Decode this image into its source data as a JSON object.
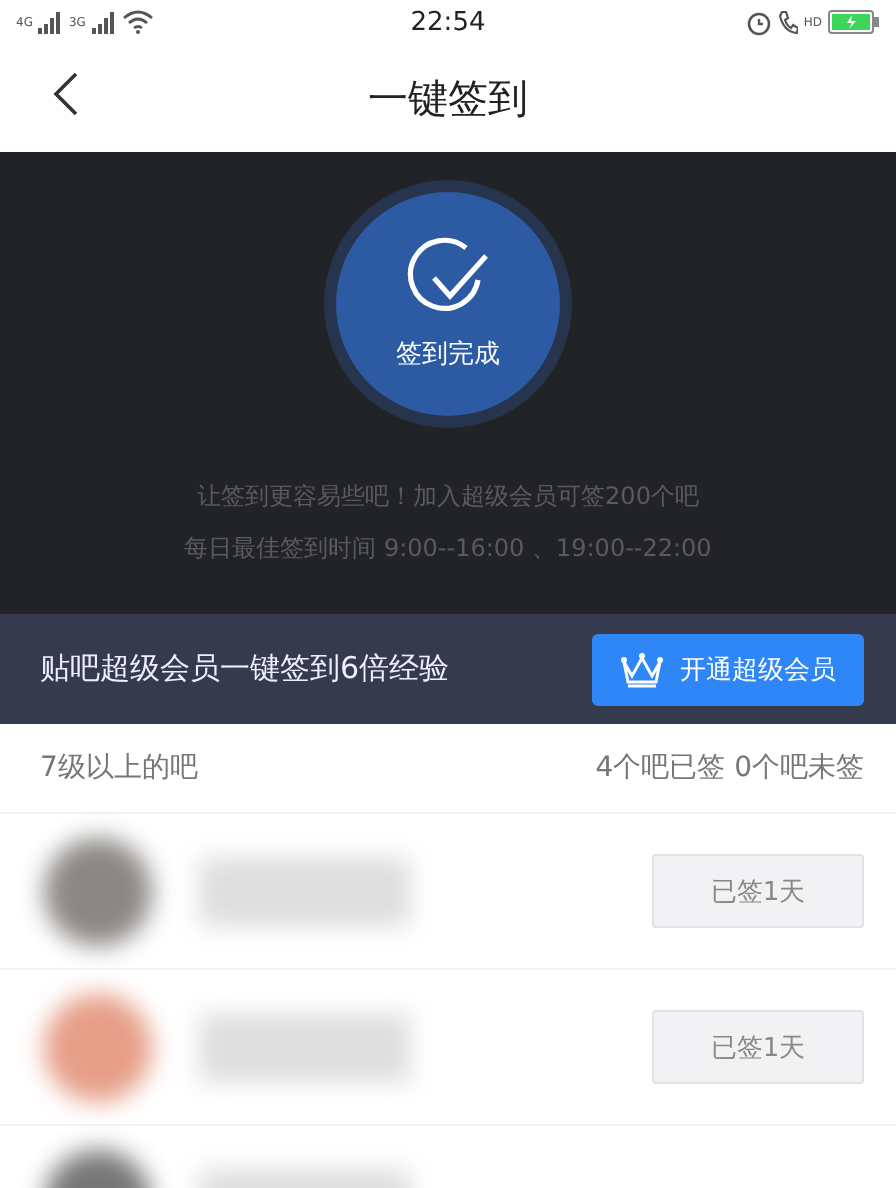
{
  "status_bar": {
    "network_1": "4G",
    "network_2": "3G",
    "time": "22:54",
    "call_label": "HD"
  },
  "header": {
    "title": "一键签到"
  },
  "sign_panel": {
    "status": "签到完成",
    "lines": [
      "让签到更容易些吧！加入超级会员可签200个吧",
      "每日最佳签到时间  9:00--16:00 、19:00--22:00"
    ]
  },
  "promo": {
    "text": "贴吧超级会员一键签到6倍经验",
    "button": "开通超级会员"
  },
  "section": {
    "title": "7级以上的吧",
    "summary": "4个吧已签 0个吧未签"
  },
  "rows": [
    {
      "status": "已签1天"
    },
    {
      "status": "已签1天"
    }
  ]
}
